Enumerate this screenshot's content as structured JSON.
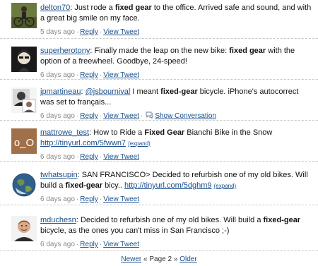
{
  "tweets": [
    {
      "user": "delton70",
      "parts": [
        ": Just rode a ",
        "fixed gear",
        " to the office. Arrived safe and sound, and with a great big smile on my face."
      ],
      "time": "5 days ago",
      "reply": "Reply",
      "view": "View Tweet"
    },
    {
      "user": "superherotony",
      "parts": [
        ": Finally made the leap on the new bike: ",
        "fixed gear",
        " with the option of a freewheel. Goodbye, 24-speed!"
      ],
      "time": "6 days ago",
      "reply": "Reply",
      "view": "View Tweet"
    },
    {
      "user": "jpmartineau",
      "mention": "@jsbournival",
      "parts": [
        " I meant ",
        "fixed-gear",
        " bicycle. iPhone's autocorrect was set to français..."
      ],
      "time": "6 days ago",
      "reply": "Reply",
      "view": "View Tweet",
      "conversation": "Show Conversation"
    },
    {
      "user": "mattrowe_test",
      "parts": [
        ": How to Ride a ",
        "Fixed Gear",
        " Bianchi Bike in the Snow "
      ],
      "url": "http://tinyurl.com/5fwwn7",
      "expand": "(expand)",
      "time": "6 days ago",
      "reply": "Reply",
      "view": "View Tweet"
    },
    {
      "user": "twhatsupin",
      "parts": [
        ": SAN FRANCISCO> Decided to refurbish one of my old bikes. Will build a ",
        "fixed-gear",
        " bicy.. "
      ],
      "url": "http://tinyurl.com/5dghm9",
      "expand": "(expand)",
      "time": "6 days ago",
      "reply": "Reply",
      "view": "View Tweet"
    },
    {
      "user": "mduchesn",
      "parts": [
        ": Decided to refurbish one of my old bikes. Will build a ",
        "fixed-gear",
        " bicycle, as the ones you can't miss in San Francisco ;-)"
      ],
      "time": "6 days ago",
      "reply": "Reply",
      "view": "View Tweet"
    }
  ],
  "pager": {
    "newer": "Newer",
    "page": "« Page 2 »",
    "older": "Older"
  },
  "colors": {
    "link": "#1a4f8b",
    "meta": "#8a8a8a",
    "divider": "#c8c8c8"
  }
}
